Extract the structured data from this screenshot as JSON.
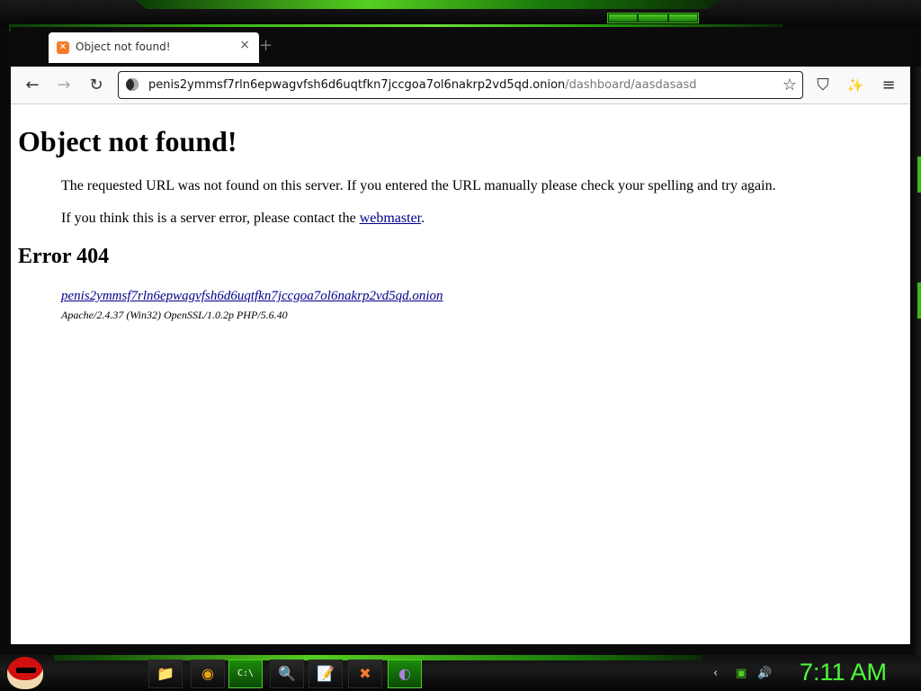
{
  "browser": {
    "tab": {
      "title": "Object not found!",
      "close": "×",
      "new_tab": "+"
    },
    "url": {
      "host": "penis2ymmsf7rln6epwagvfsh6d6uqtfkn7jccgoa7ol6nakrp2vd5qd.onion",
      "path": "/dashboard/aasdasasd"
    },
    "nav": {
      "back": "←",
      "forward": "→",
      "reload": "↻",
      "star": "☆",
      "shield": "⛉",
      "extensions": "✨",
      "menu": "≡"
    }
  },
  "page": {
    "title": "Object not found!",
    "paragraph1": "The requested URL was not found on this server. If you entered the URL manually please check your spelling and try again.",
    "paragraph2_prefix": "If you think this is a server error, please contact the ",
    "webmaster_link": "webmaster",
    "paragraph2_suffix": ".",
    "error_heading": "Error 404",
    "server_address": "penis2ymmsf7rln6epwagvfsh6d6uqtfkn7jccgoa7ol6nakrp2vd5qd.onion",
    "server_signature": "Apache/2.4.37 (Win32) OpenSSL/1.0.2p PHP/5.6.40"
  },
  "taskbar": {
    "items": [
      {
        "icon": "file-explorer-icon",
        "glyph": "📁"
      },
      {
        "icon": "chrome-icon",
        "glyph": "◉"
      },
      {
        "icon": "command-prompt-icon",
        "glyph": "C:\\"
      },
      {
        "icon": "search-tool-icon",
        "glyph": "🔍"
      },
      {
        "icon": "notepad-icon",
        "glyph": "📝"
      },
      {
        "icon": "xampp-icon",
        "glyph": "✖"
      },
      {
        "icon": "tor-browser-icon",
        "glyph": "◐"
      }
    ],
    "clock": "7:11 AM"
  },
  "colors": {
    "accent": "#4ccf22",
    "link": "#00008b",
    "clock": "#4cff3a"
  }
}
